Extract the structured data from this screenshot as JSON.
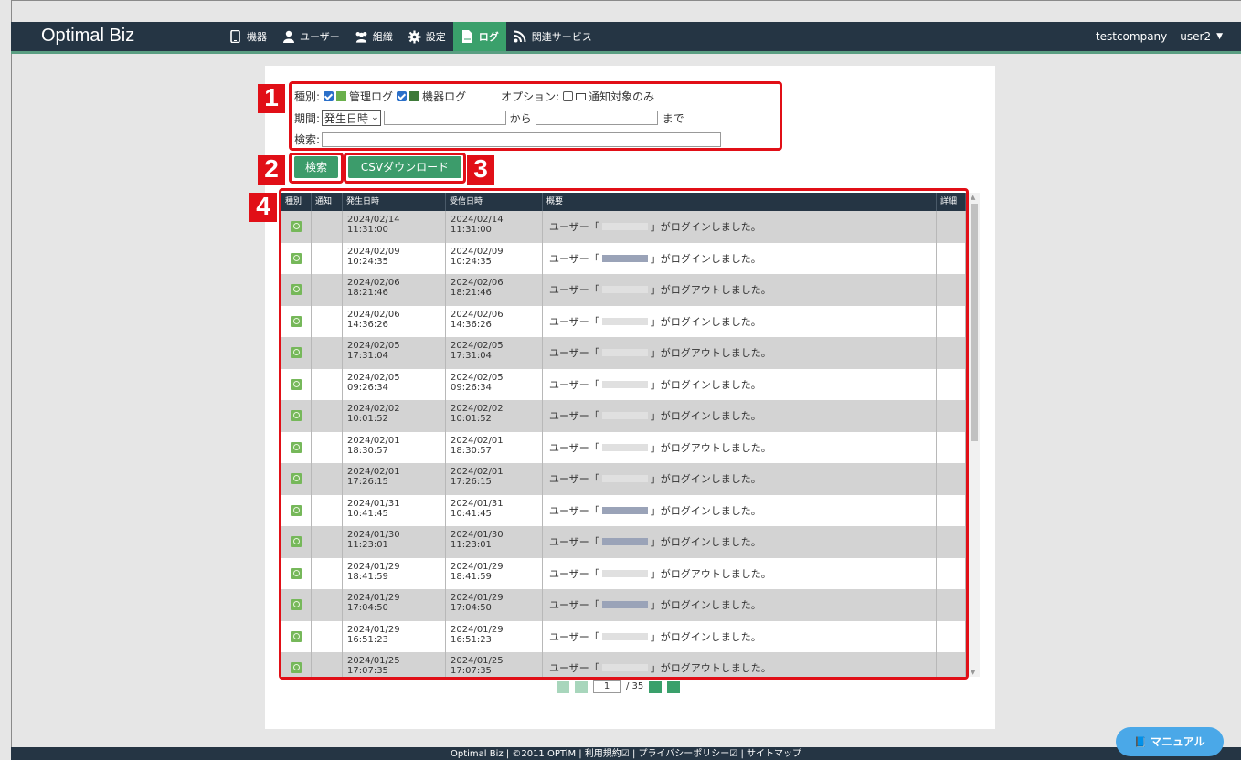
{
  "header": {
    "brand": "Optimal Biz",
    "nav": [
      {
        "label": "機器",
        "icon": "device-icon"
      },
      {
        "label": "ユーザー",
        "icon": "user-icon"
      },
      {
        "label": "組織",
        "icon": "group-icon"
      },
      {
        "label": "設定",
        "icon": "gear-icon"
      },
      {
        "label": "ログ",
        "icon": "document-icon",
        "active": true
      },
      {
        "label": "関連サービス",
        "icon": "rss-icon"
      }
    ],
    "company": "testcompany",
    "user": "user2"
  },
  "filters": {
    "type_label": "種別:",
    "admin_log": "管理ログ",
    "device_log": "機器ログ",
    "option_label": "オプション:",
    "notify_only": "通知対象のみ",
    "period_label": "期間:",
    "period_select": "発生日時",
    "from": "から",
    "until": "まで",
    "search_label": "検索:"
  },
  "buttons": {
    "search": "検索",
    "csv": "CSVダウンロード"
  },
  "callouts": [
    "1",
    "2",
    "3",
    "4"
  ],
  "table": {
    "headers": [
      "種別",
      "通知",
      "発生日時",
      "受信日時",
      "概要",
      "詳細"
    ],
    "rows": [
      {
        "d": "2024/02/14",
        "t": "11:31:00",
        "pre": "ユーザー「",
        "post": "」がログインしました。"
      },
      {
        "d": "2024/02/09",
        "t": "10:24:35",
        "pre": "ユーザー「",
        "post": "」がログインしました。"
      },
      {
        "d": "2024/02/06",
        "t": "18:21:46",
        "pre": "ユーザー「",
        "post": "」がログアウトしました。"
      },
      {
        "d": "2024/02/06",
        "t": "14:36:26",
        "pre": "ユーザー「",
        "post": "」がログインしました。"
      },
      {
        "d": "2024/02/05",
        "t": "17:31:04",
        "pre": "ユーザー「",
        "post": "」がログアウトしました。"
      },
      {
        "d": "2024/02/05",
        "t": "09:26:34",
        "pre": "ユーザー「",
        "post": "」がログインしました。"
      },
      {
        "d": "2024/02/02",
        "t": "10:01:52",
        "pre": "ユーザー「",
        "post": "」がログインしました。"
      },
      {
        "d": "2024/02/01",
        "t": "18:30:57",
        "pre": "ユーザー「",
        "post": "」がログアウトしました。"
      },
      {
        "d": "2024/02/01",
        "t": "17:26:15",
        "pre": "ユーザー「",
        "post": "」がログインしました。"
      },
      {
        "d": "2024/01/31",
        "t": "10:41:45",
        "pre": "ユーザー「",
        "post": "」がログインしました。"
      },
      {
        "d": "2024/01/30",
        "t": "11:23:01",
        "pre": "ユーザー「",
        "post": "」がログインしました。"
      },
      {
        "d": "2024/01/29",
        "t": "18:41:59",
        "pre": "ユーザー「",
        "post": "」がログアウトしました。"
      },
      {
        "d": "2024/01/29",
        "t": "17:04:50",
        "pre": "ユーザー「",
        "post": "」がログインしました。"
      },
      {
        "d": "2024/01/29",
        "t": "16:51:23",
        "pre": "ユーザー「",
        "post": "」がログインしました。"
      },
      {
        "d": "2024/01/25",
        "t": "17:07:35",
        "pre": "ユーザー「",
        "post": "」がログアウトしました。"
      }
    ]
  },
  "pager": {
    "current": "1",
    "total": "/ 35"
  },
  "footer": "Optimal Biz | ©2011 OPTiM | 利用規約☑ | プライバシーポリシー☑ | サイトマップ",
  "manual": "マニュアル",
  "colors": {
    "navbar": "#253544",
    "accent": "#3aa06b",
    "callout": "#e10f17"
  }
}
